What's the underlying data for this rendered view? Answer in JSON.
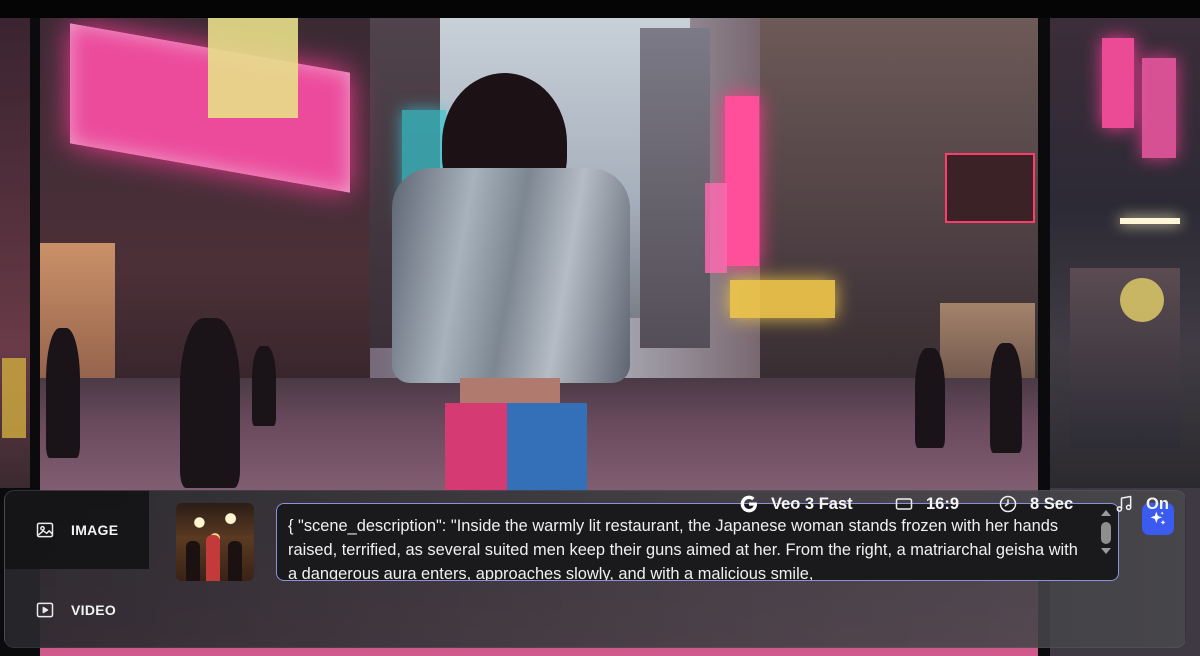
{
  "modes": [
    {
      "label": "IMAGE",
      "icon": "image-icon",
      "active": true
    },
    {
      "label": "VIDEO",
      "icon": "play-icon",
      "active": false
    }
  ],
  "prompt": {
    "text": "{ \"scene_description\": \"Inside the warmly lit restaurant, the Japanese woman stands frozen with her hands raised, terrified, as several suited men keep their guns aimed at her. From the right, a matriarchal geisha with a dangerous aura enters, approaches slowly, and with a malicious smile,"
  },
  "options": {
    "model": "Veo 3 Fast",
    "aspect_ratio": "16:9",
    "duration": "8 Sec",
    "audio": "On"
  },
  "colors": {
    "accent": "#3b5bf0",
    "prompt_border": "#8a92d8",
    "panel_bg": "#2c2c30"
  }
}
